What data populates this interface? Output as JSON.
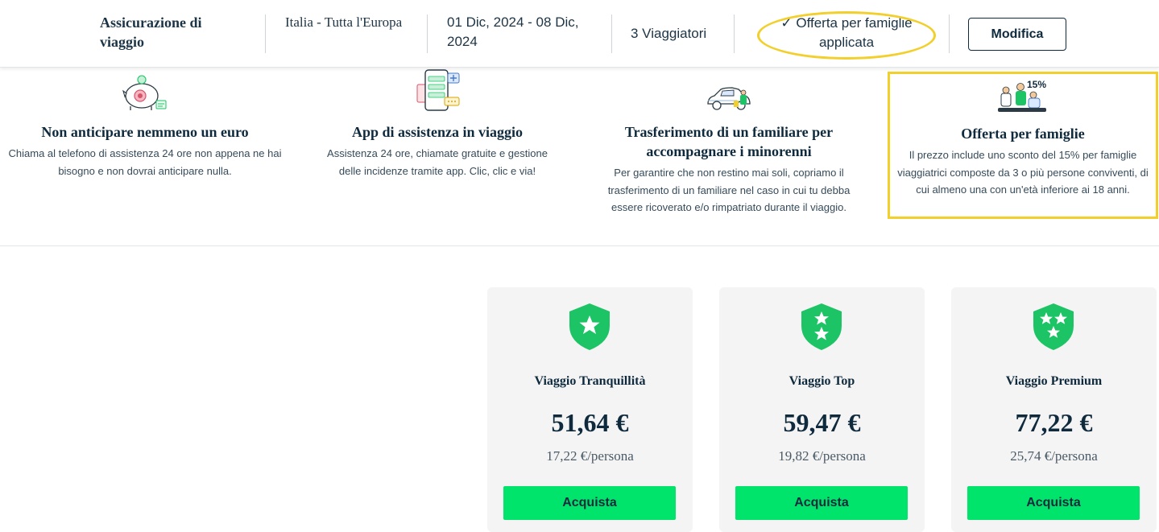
{
  "summary": {
    "product": "Assicurazione di viaggio",
    "destination": "Italia - Tutta l'Europa",
    "dates": "01 Dic, 2024 - 08 Dic, 2024",
    "travellers": "3  Viaggiatori",
    "offer_status": "✓ Offerta per famiglie applicata",
    "edit_label": "Modifica"
  },
  "benefits": [
    {
      "icon": "piggy-bank-icon",
      "title": "Non anticipare nemmeno un euro",
      "text": "Chiama al telefono di assistenza 24 ore non appena ne hai bisogno e non dovrai anticipare nulla."
    },
    {
      "icon": "phone-app-icon",
      "title": "App di assistenza in viaggio",
      "text": "Assistenza 24 ore, chiamate gratuite e gestione delle incidenze tramite app. Clic, clic e via!"
    },
    {
      "icon": "car-family-icon",
      "title": "Trasferimento di un familiare per accompagnare i minorenni",
      "text": "Per garantire che non restino mai soli, copriamo il trasferimento di un familiare nel caso in cui tu debba essere ricoverato e/o rimpatriato durante il viaggio."
    },
    {
      "icon": "family-discount-icon",
      "badge": "15%",
      "title": "Offerta per famiglie",
      "text": "Il prezzo include uno sconto del 15% per famiglie viaggiatrici composte da 3 o più persone conviventi, di cui almeno una con un'età inferiore ai 18 anni."
    }
  ],
  "plans": [
    {
      "name": "Viaggio Tranquillità",
      "stars": 1,
      "price": "51,64 €",
      "per_person": "17,22 €/persona",
      "cta": "Acquista"
    },
    {
      "name": "Viaggio Top",
      "stars": 2,
      "price": "59,47 €",
      "per_person": "19,82 €/persona",
      "cta": "Acquista"
    },
    {
      "name": "Viaggio Premium",
      "stars": 3,
      "price": "77,22 €",
      "per_person": "25,74 €/persona",
      "cta": "Acquista"
    }
  ],
  "colors": {
    "accent_green": "#00e46b",
    "shield_green": "#1cc466",
    "highlight_yellow": "#f2cf2a",
    "text_dark": "#0f2a3d",
    "card_bg": "#f4f4f4"
  }
}
